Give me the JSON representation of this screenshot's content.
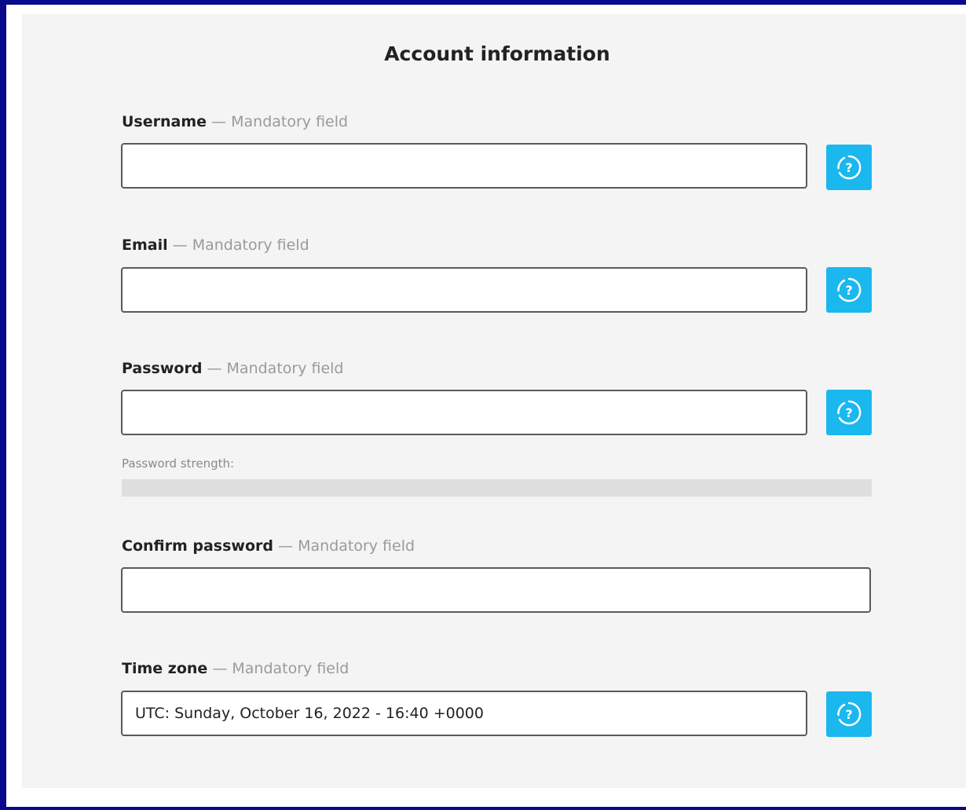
{
  "form": {
    "title": "Account information",
    "mandatory_sep": "—",
    "mandatory_text": "Mandatory field",
    "fields": {
      "username": {
        "label": "Username",
        "value": ""
      },
      "email": {
        "label": "Email",
        "value": ""
      },
      "password": {
        "label": "Password",
        "value": ""
      },
      "confirm_password": {
        "label": "Confirm password",
        "value": ""
      },
      "timezone": {
        "label": "Time zone",
        "value": "UTC: Sunday, October 16, 2022 - 16:40 +0000"
      }
    },
    "password_strength": {
      "label": "Password strength:",
      "value": 0
    },
    "help_icon": "help-question-icon"
  },
  "colors": {
    "frame": "#0a0a8c",
    "accent": "#1ab8ee",
    "panel_bg": "#f4f4f4"
  }
}
